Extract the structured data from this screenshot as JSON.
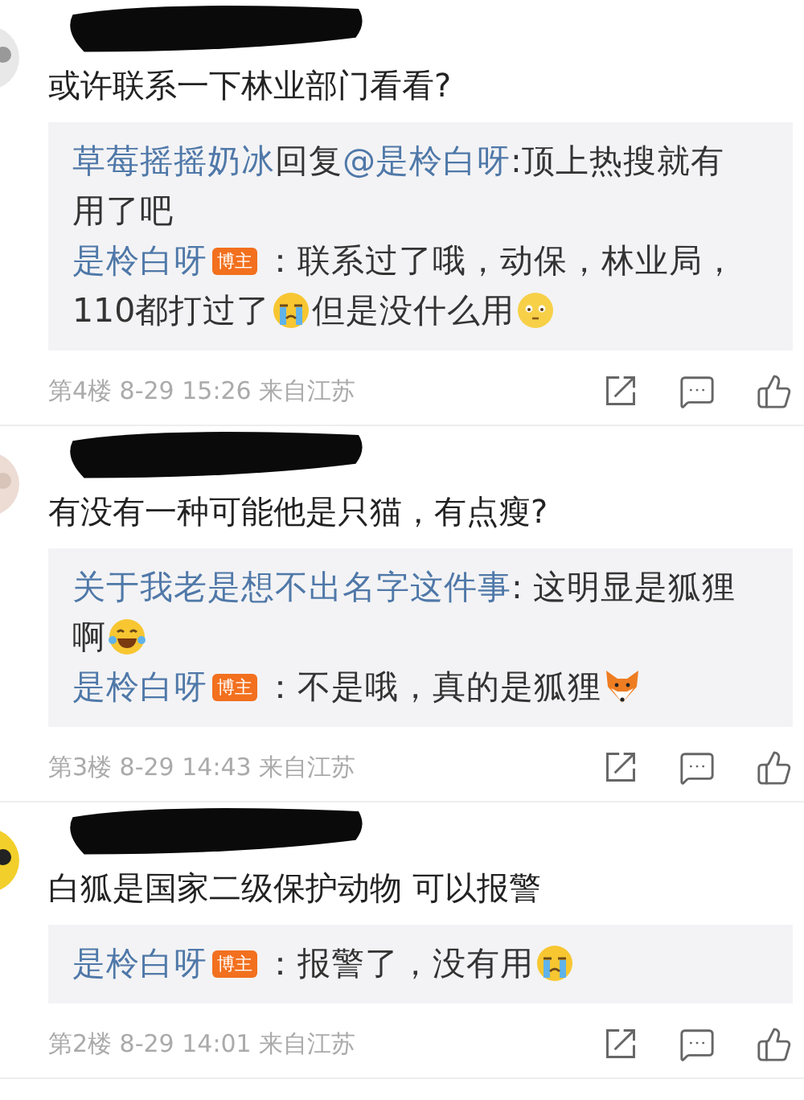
{
  "comments": [
    {
      "name_redacted": true,
      "text": "或许联系一下林业部门看看?",
      "replies": [
        {
          "parts": [
            {
              "kind": "user",
              "text": "草莓摇摇奶冰"
            },
            {
              "kind": "text",
              "text": "回复"
            },
            {
              "kind": "mention",
              "text": "@是柃白呀"
            },
            {
              "kind": "text",
              "text": ":顶上热搜就有"
            },
            {
              "kind": "text",
              "text": "用了吧"
            }
          ]
        },
        {
          "parts": [
            {
              "kind": "user",
              "text": "是柃白呀"
            },
            {
              "kind": "badge",
              "text": "博主"
            },
            {
              "kind": "text",
              "text": "：联系过了哦，动保，林业局，"
            },
            {
              "kind": "text",
              "text": "110都打过了"
            },
            {
              "kind": "crying"
            },
            {
              "kind": "text",
              "text": "但是没什么用"
            },
            {
              "kind": "flushed"
            }
          ]
        }
      ],
      "meta": "第4楼 8-29 15:26 来自江苏"
    },
    {
      "name_redacted": true,
      "text": "有没有一种可能他是只猫，有点瘦?",
      "replies": [
        {
          "parts": [
            {
              "kind": "user",
              "text": "关于我老是想不出名字这件事"
            },
            {
              "kind": "text",
              "text": ": 这明显是狐狸"
            },
            {
              "kind": "text",
              "text": "啊"
            },
            {
              "kind": "laughing"
            }
          ]
        },
        {
          "parts": [
            {
              "kind": "user",
              "text": "是柃白呀"
            },
            {
              "kind": "badge",
              "text": "博主"
            },
            {
              "kind": "text",
              "text": "：不是哦，真的是狐狸"
            },
            {
              "kind": "fox"
            }
          ]
        }
      ],
      "meta": "第3楼 8-29 14:43 来自江苏"
    },
    {
      "name_redacted": true,
      "text": "白狐是国家二级保护动物 可以报警",
      "replies": [
        {
          "parts": [
            {
              "kind": "user",
              "text": "是柃白呀"
            },
            {
              "kind": "badge",
              "text": "博主"
            },
            {
              "kind": "text",
              "text": "：报警了，没有用"
            },
            {
              "kind": "crying"
            }
          ]
        }
      ],
      "meta": "第2楼 8-29 14:01 来自江苏"
    }
  ]
}
